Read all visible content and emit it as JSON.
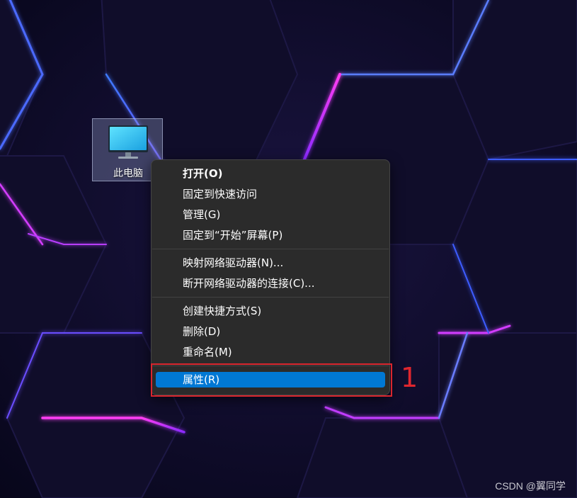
{
  "desktop": {
    "icon": {
      "label": "此电脑",
      "icon_name": "monitor-icon"
    }
  },
  "context_menu": {
    "groups": [
      {
        "items": [
          {
            "label": "打开(O)",
            "bold": true
          },
          {
            "label": "固定到快速访问"
          },
          {
            "label": "管理(G)"
          },
          {
            "label": "固定到“开始”屏幕(P)"
          }
        ]
      },
      {
        "items": [
          {
            "label": "映射网络驱动器(N)..."
          },
          {
            "label": "断开网络驱动器的连接(C)..."
          }
        ]
      },
      {
        "items": [
          {
            "label": "创建快捷方式(S)"
          },
          {
            "label": "删除(D)"
          },
          {
            "label": "重命名(M)"
          }
        ]
      },
      {
        "items": [
          {
            "label": "属性(R)",
            "selected": true
          }
        ]
      }
    ],
    "highlight_color": "#0078d4"
  },
  "annotation": {
    "number": "1",
    "color": "#d9262e"
  },
  "watermark": "CSDN @翼同学"
}
